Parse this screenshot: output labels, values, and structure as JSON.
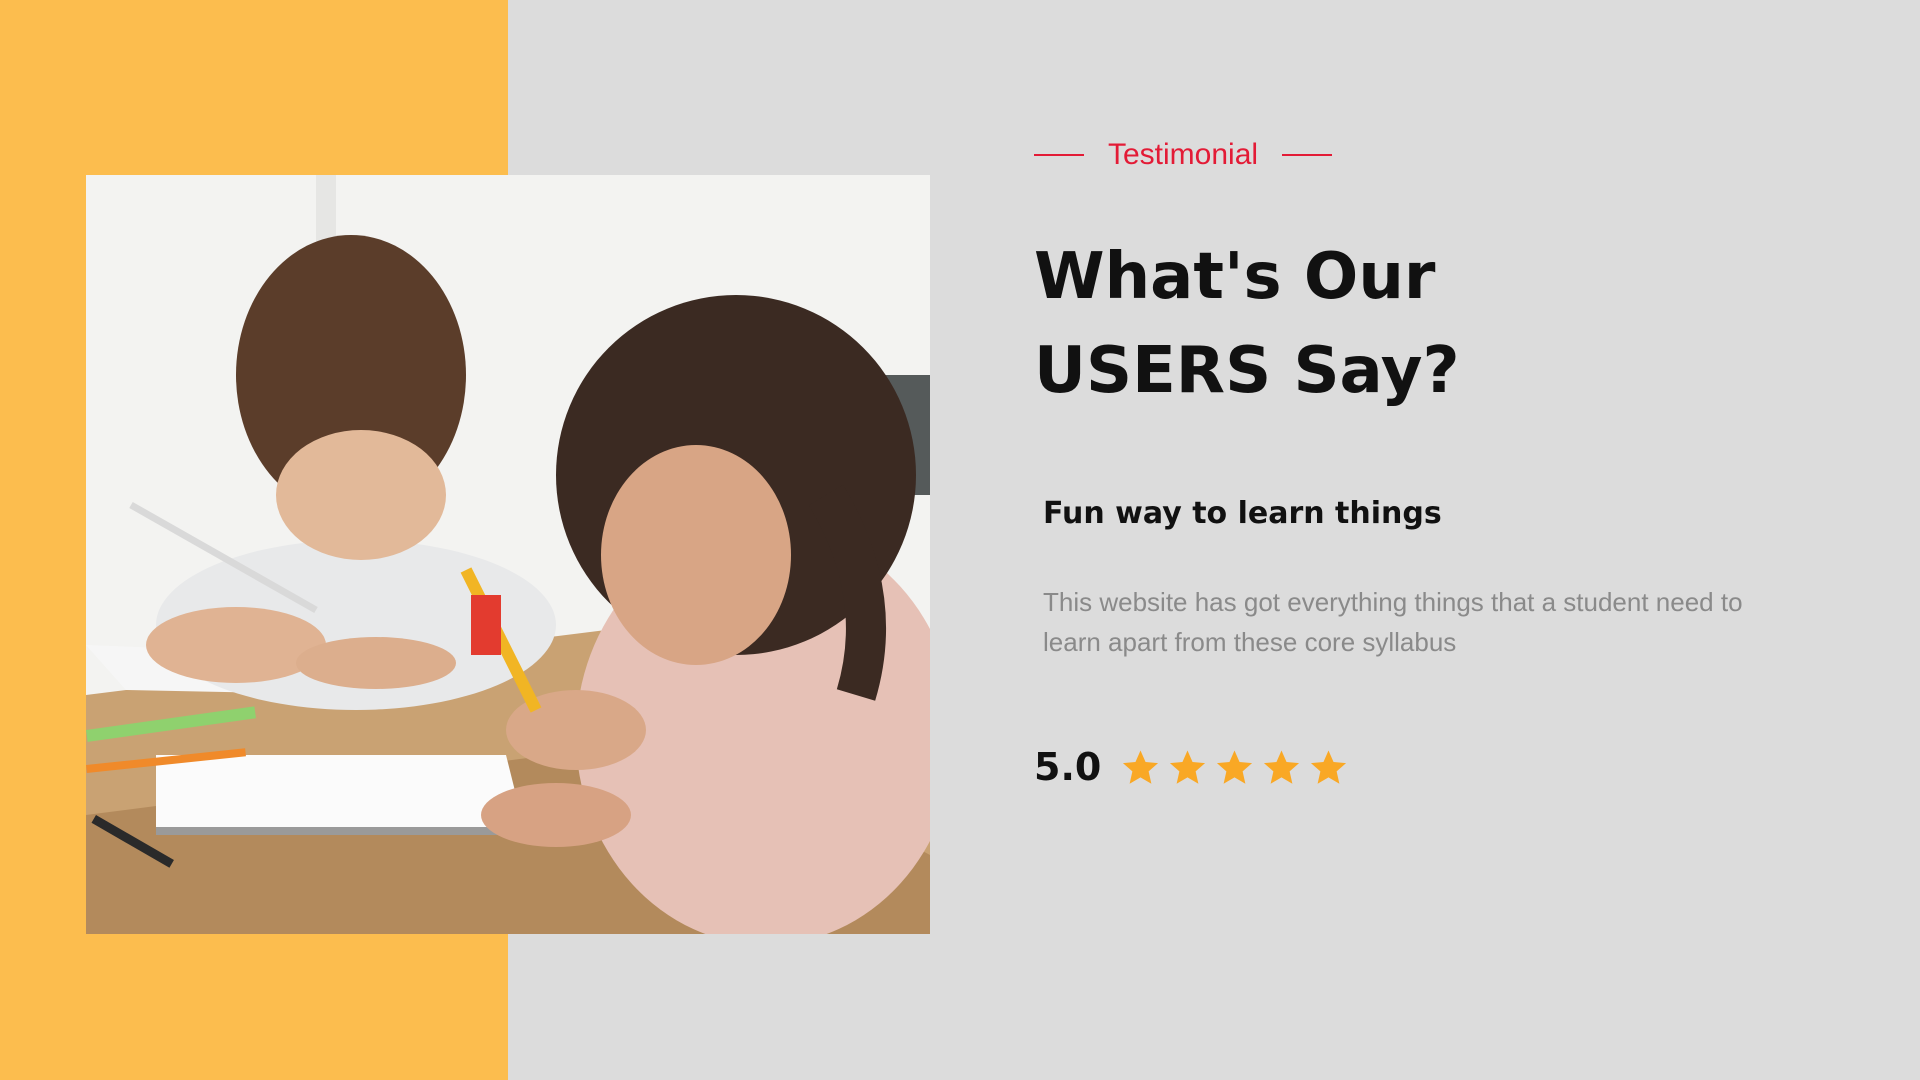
{
  "testimonial": {
    "eyebrow": "Testimonial",
    "heading_line1": "What's Our",
    "heading_line2": "USERS Say?",
    "quote_title": "Fun way to learn things",
    "quote_body": "This website has got everything things that a student need to learn apart from these core syllabus",
    "rating": {
      "score_text": "5.0",
      "stars": 5,
      "max_stars": 5
    }
  },
  "colors": {
    "accent_yellow": "#fcbd4e",
    "background": "#dcdcdc",
    "eyebrow_red": "#e31b36",
    "star_color": "#f9a825"
  },
  "image": {
    "icon": "photo-children-studying"
  }
}
